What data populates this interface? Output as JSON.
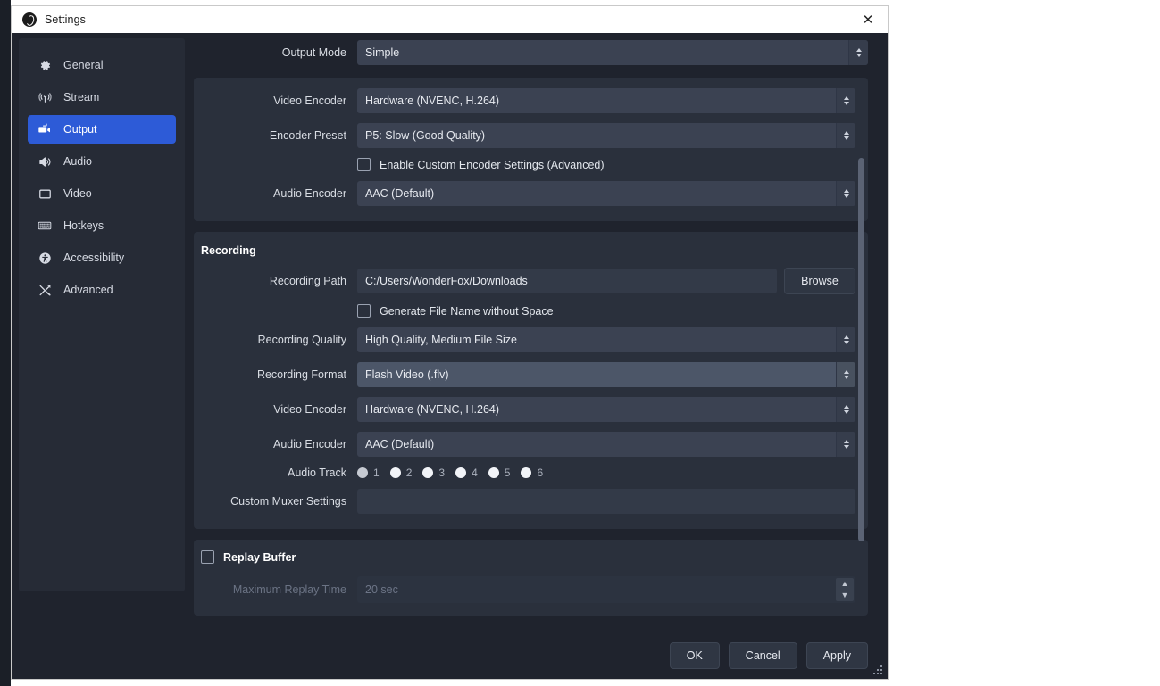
{
  "window": {
    "title": "Settings",
    "logo_icon": "obs-logo-icon",
    "close_icon": "close-icon"
  },
  "sidebar": {
    "items": [
      {
        "label": "General",
        "icon": "gear-icon",
        "active": false
      },
      {
        "label": "Stream",
        "icon": "broadcast-icon",
        "active": false
      },
      {
        "label": "Output",
        "icon": "output-camera-icon",
        "active": true
      },
      {
        "label": "Audio",
        "icon": "speaker-icon",
        "active": false
      },
      {
        "label": "Video",
        "icon": "monitor-icon",
        "active": false
      },
      {
        "label": "Hotkeys",
        "icon": "keyboard-icon",
        "active": false
      },
      {
        "label": "Accessibility",
        "icon": "accessibility-icon",
        "active": false
      },
      {
        "label": "Advanced",
        "icon": "tools-icon",
        "active": false
      }
    ]
  },
  "colors": {
    "accent": "#2d5bd7",
    "dialog_bg": "#1f232d",
    "panel_bg": "#2a303c",
    "field_bg": "#3b4252",
    "field_hover_bg": "#4c5668"
  },
  "output_mode": {
    "label": "Output Mode",
    "value": "Simple"
  },
  "streaming": {
    "video_encoder": {
      "label": "Video Encoder",
      "value": "Hardware (NVENC, H.264)"
    },
    "encoder_preset": {
      "label": "Encoder Preset",
      "value": "P5: Slow (Good Quality)"
    },
    "custom_encoder": {
      "label": "Enable Custom Encoder Settings (Advanced)",
      "checked": false
    },
    "audio_encoder": {
      "label": "Audio Encoder",
      "value": "AAC (Default)"
    }
  },
  "recording": {
    "title": "Recording",
    "path": {
      "label": "Recording Path",
      "value": "C:/Users/WonderFox/Downloads",
      "browse_label": "Browse"
    },
    "generate_no_space": {
      "label": "Generate File Name without Space",
      "checked": false
    },
    "quality": {
      "label": "Recording Quality",
      "value": "High Quality, Medium File Size"
    },
    "format": {
      "label": "Recording Format",
      "value": "Flash Video (.flv)",
      "hovered": true
    },
    "video_encoder": {
      "label": "Video Encoder",
      "value": "Hardware (NVENC, H.264)"
    },
    "audio_encoder": {
      "label": "Audio Encoder",
      "value": "AAC (Default)"
    },
    "audio_track": {
      "label": "Audio Track",
      "options": [
        "1",
        "2",
        "3",
        "4",
        "5",
        "6"
      ],
      "selected": "1"
    },
    "muxer": {
      "label": "Custom Muxer Settings",
      "value": ""
    }
  },
  "replay_buffer": {
    "label": "Replay Buffer",
    "checked": false,
    "max_time": {
      "label": "Maximum Replay Time",
      "value": "20 sec",
      "disabled": true
    }
  },
  "footer": {
    "ok_label": "OK",
    "cancel_label": "Cancel",
    "apply_label": "Apply"
  }
}
